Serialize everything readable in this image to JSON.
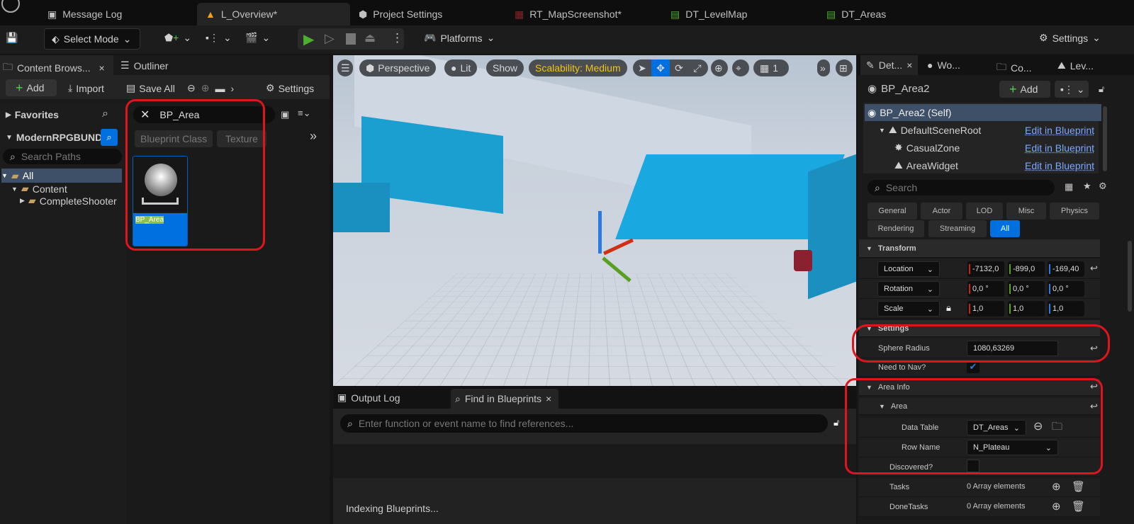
{
  "tabs": [
    {
      "label": "Message Log",
      "icon": "message-log-icon"
    },
    {
      "label": "L_Overview*",
      "icon": "level-icon",
      "active": true
    },
    {
      "label": "Project Settings",
      "icon": "settings-cube-icon"
    },
    {
      "label": "RT_MapScreenshot*",
      "icon": "texture-icon"
    },
    {
      "label": "DT_LevelMap",
      "icon": "datatable-icon"
    },
    {
      "label": "DT_Areas",
      "icon": "datatable-icon"
    }
  ],
  "toolbar": {
    "select_mode": "Select Mode",
    "platforms": "Platforms",
    "settings": "Settings"
  },
  "content_browser": {
    "tab_label": "Content Brows...",
    "outliner_label": "Outliner",
    "add": "Add",
    "import": "Import",
    "save_all": "Save All",
    "settings": "Settings",
    "favorites": "Favorites",
    "root": "ModernRPGBUND",
    "search_paths_placeholder": "Search Paths",
    "tree": [
      "All",
      "Content",
      "CompleteShooter"
    ],
    "search_value": "BP_Area",
    "filters": [
      "Blueprint Class",
      "Texture"
    ],
    "asset": {
      "name": "BP_Area"
    }
  },
  "viewport": {
    "perspective": "Perspective",
    "lit": "Lit",
    "show": "Show",
    "scalability": "Scalability: Medium",
    "grid_value": "1"
  },
  "bottom": {
    "output_log": "Output Log",
    "find_in_blueprints": "Find in Blueprints",
    "search_placeholder": "Enter function or event name to find references...",
    "status": "Indexing Blueprints..."
  },
  "details": {
    "tabs": [
      "Det...",
      "Wo...",
      "Co...",
      "Lev..."
    ],
    "actor": "BP_Area2",
    "add": "Add",
    "components": [
      {
        "name": "BP_Area2 (Self)"
      },
      {
        "name": "DefaultSceneRoot",
        "link": "Edit in Blueprint"
      },
      {
        "name": "CasualZone",
        "link": "Edit in Blueprint"
      },
      {
        "name": "AreaWidget",
        "link": "Edit in Blueprint"
      }
    ],
    "search_placeholder": "Search",
    "categories": [
      "General",
      "Actor",
      "LOD",
      "Misc",
      "Physics",
      "Rendering",
      "Streaming",
      "All"
    ],
    "transform": {
      "title": "Transform",
      "location": {
        "label": "Location",
        "x": "-7132,0",
        "y": "-899,0",
        "z": "-169,40"
      },
      "rotation": {
        "label": "Rotation",
        "x": "0,0 °",
        "y": "0,0 °",
        "z": "0,0 °"
      },
      "scale": {
        "label": "Scale",
        "x": "1,0",
        "y": "1,0",
        "z": "1,0"
      }
    },
    "settings": {
      "title": "Settings",
      "sphere_radius_label": "Sphere Radius",
      "sphere_radius": "1080,63269",
      "need_to_nav_label": "Need to Nav?",
      "need_to_nav": true
    },
    "area_info": {
      "title": "Area Info",
      "area": "Area",
      "data_table_label": "Data Table",
      "data_table": "DT_Areas",
      "row_name_label": "Row Name",
      "row_name": "N_Plateau",
      "discovered_label": "Discovered?",
      "discovered": false,
      "tasks_label": "Tasks",
      "tasks": "0 Array elements",
      "done_tasks_label": "DoneTasks",
      "done_tasks": "0 Array elements"
    }
  },
  "colors": {
    "accent": "#0070e0",
    "annotation": "#e0141c",
    "link": "#7aa9ff",
    "play": "#4caf30",
    "scalability": "#f0c419"
  }
}
